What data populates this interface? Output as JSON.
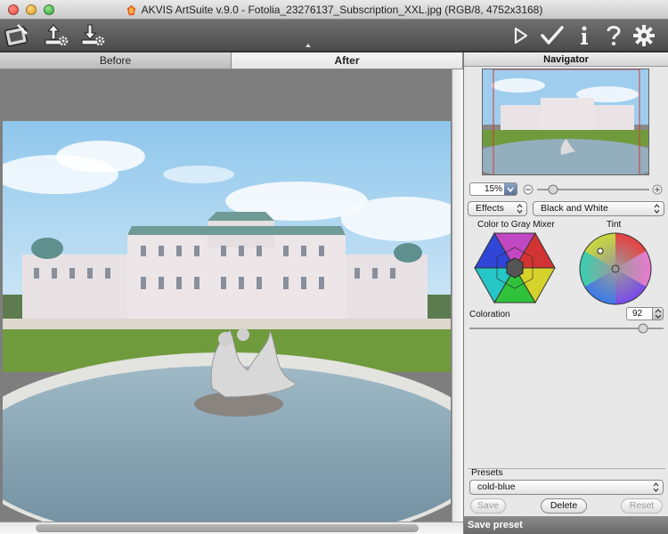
{
  "window": {
    "title": "AKVIS ArtSuite v.9.0 - Fotolia_23276137_Subscription_XXL.jpg (RGB/8, 4752x3168)"
  },
  "toolbar": {
    "left_buttons": [
      "collage-icon",
      "open-file-icon",
      "save-file-icon"
    ],
    "right_buttons": [
      "run-icon",
      "apply-check-icon",
      "info-icon",
      "help-icon",
      "settings-gear-icon"
    ]
  },
  "tabs": [
    {
      "label": "Before",
      "active": false
    },
    {
      "label": "After",
      "active": true
    }
  ],
  "navigator": {
    "title": "Navigator",
    "zoom": "15%"
  },
  "effect": {
    "category": "Effects",
    "name": "Black and White"
  },
  "mixer": {
    "left_label": "Color to Gray Mixer",
    "right_label": "Tint"
  },
  "coloration": {
    "label": "Coloration",
    "value": "92"
  },
  "presets": {
    "label": "Presets",
    "selected": "cold-blue",
    "save_label": "Save",
    "delete_label": "Delete",
    "reset_label": "Reset"
  },
  "status": {
    "text": "Save preset"
  },
  "colors": {
    "sky": "#a7d3f0",
    "accent": "#5a6f97"
  }
}
